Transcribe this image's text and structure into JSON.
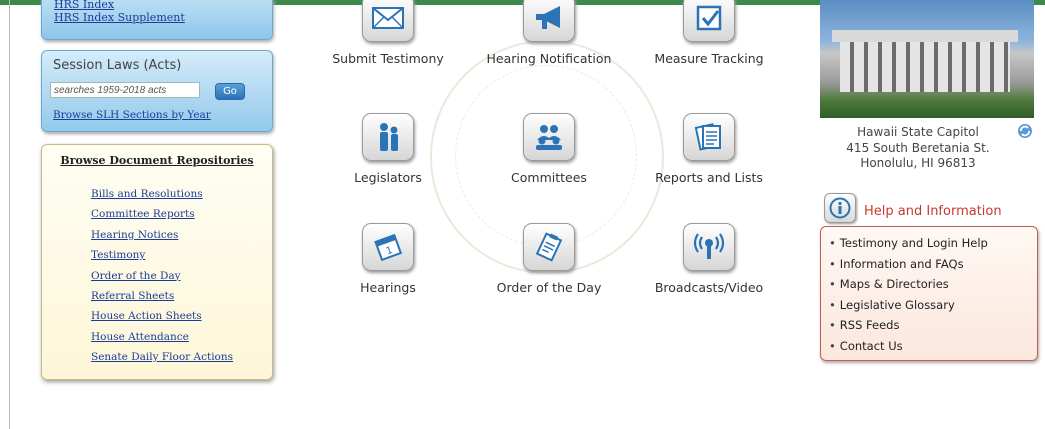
{
  "left": {
    "hrs_links": [
      "HRS Index",
      "HRS Index Supplement"
    ],
    "session_laws": {
      "title": "Session Laws (Acts)",
      "search_placeholder": "searches 1959-2018 acts",
      "go_label": "Go",
      "browse_link": "Browse SLH Sections by Year"
    },
    "repositories": {
      "title": "Browse Document Repositories",
      "items": [
        "Bills and Resolutions",
        "Committee Reports",
        "Hearing Notices",
        "Testimony",
        "Order of the Day",
        "Referral Sheets",
        "House Action Sheets",
        "House Attendance",
        "Senate Daily Floor Actions"
      ]
    }
  },
  "center": {
    "tiles": [
      {
        "label": "Submit Testimony",
        "icon": "envelope-icon"
      },
      {
        "label": "Hearing Notification",
        "icon": "megaphone-icon"
      },
      {
        "label": "Measure Tracking",
        "icon": "checkbox-icon"
      },
      {
        "label": "Legislators",
        "icon": "people-icon"
      },
      {
        "label": "Committees",
        "icon": "group-icon"
      },
      {
        "label": "Reports and Lists",
        "icon": "documents-icon"
      },
      {
        "label": "Hearings",
        "icon": "calendar-icon"
      },
      {
        "label": "Order of the Day",
        "icon": "clipboard-icon"
      },
      {
        "label": "Broadcasts/Video",
        "icon": "broadcast-icon"
      }
    ]
  },
  "right": {
    "address": [
      "Hawaii State Capitol",
      "415 South Beretania St.",
      "Honolulu, HI 96813"
    ],
    "help": {
      "title": "Help and Information",
      "items": [
        "Testimony and Login Help",
        "Information and FAQs",
        "Maps & Directories",
        "Legislative Glossary",
        "RSS Feeds",
        "Contact Us"
      ]
    }
  },
  "colors": {
    "accent_green": "#3b8a4a",
    "icon_blue": "#2a73b5",
    "help_red": "#c33b2e",
    "link_blue": "#1a3d99"
  }
}
